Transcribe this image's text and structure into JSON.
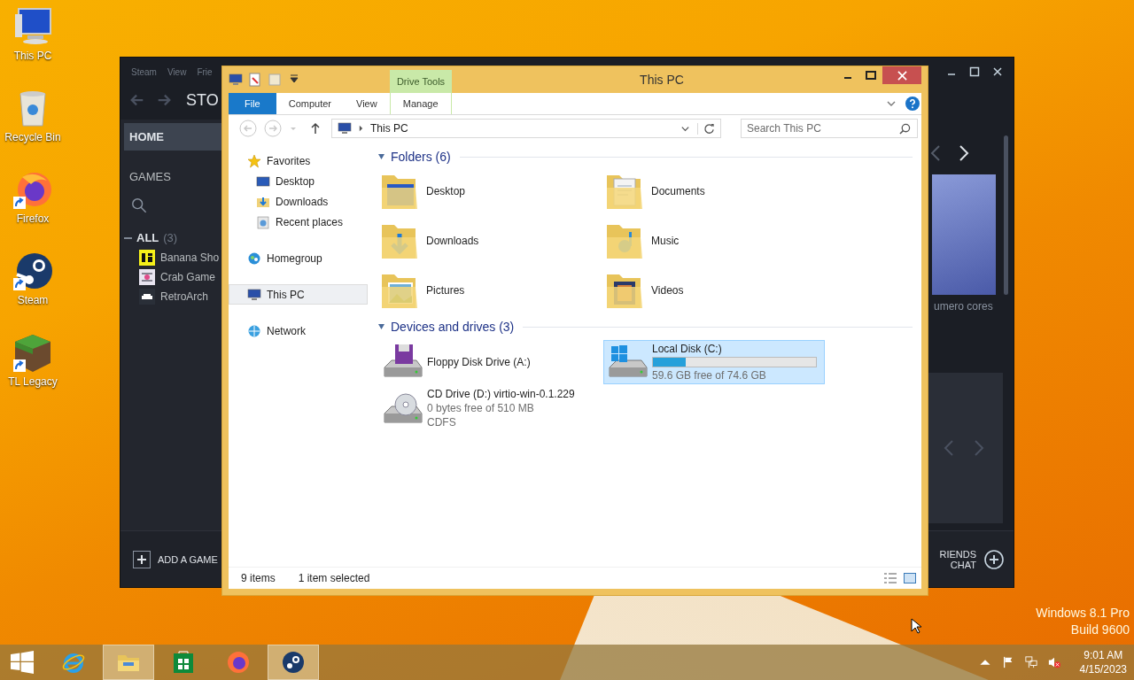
{
  "desktop": {
    "icons": [
      {
        "label": "This PC",
        "kind": "pc",
        "shortcut": false
      },
      {
        "label": "Recycle Bin",
        "kind": "bin",
        "shortcut": false
      },
      {
        "label": "Firefox",
        "kind": "firefox",
        "shortcut": true
      },
      {
        "label": "Steam",
        "kind": "steam",
        "shortcut": true
      },
      {
        "label": "TL Legacy",
        "kind": "grass",
        "shortcut": true
      }
    ],
    "watermark": [
      "Windows 8.1 Pro",
      "Build 9600"
    ]
  },
  "steam_window": {
    "menu": [
      "Steam",
      "View",
      "Frie"
    ],
    "heading": "STO",
    "sidebar": {
      "home": "HOME",
      "games": "GAMES",
      "group_label": "ALL",
      "group_count": "(3)",
      "games_list": [
        {
          "name": "Banana Sho",
          "kind": "banana"
        },
        {
          "name": "Crab Game",
          "kind": "crab"
        },
        {
          "name": "RetroArch",
          "kind": "retro"
        }
      ]
    },
    "card_caption": "umero cores",
    "add_game": "ADD A GAME",
    "friends": [
      "RIENDS",
      "CHAT"
    ]
  },
  "explorer": {
    "title": "This PC",
    "context_group": "Drive Tools",
    "tabs": [
      {
        "label": "File",
        "kind": "file"
      },
      {
        "label": "Computer",
        "kind": "normal"
      },
      {
        "label": "View",
        "kind": "normal"
      },
      {
        "label": "Manage",
        "kind": "contextual"
      }
    ],
    "address": "This PC",
    "search": {
      "placeholder": "Search This PC"
    },
    "nav": [
      {
        "label": "Favorites",
        "kind": "star",
        "selected": false,
        "children": [
          {
            "label": "Desktop",
            "kind": "desktop",
            "selected": false
          },
          {
            "label": "Downloads",
            "kind": "downloads",
            "selected": false
          },
          {
            "label": "Recent places",
            "kind": "recent",
            "selected": false
          }
        ]
      },
      {
        "label": "Homegroup",
        "kind": "homegroup",
        "selected": false
      },
      {
        "label": "This PC",
        "kind": "pc",
        "selected": true
      },
      {
        "label": "Network",
        "kind": "network",
        "selected": false
      }
    ],
    "folders_heading": "Folders (6)",
    "folders": [
      {
        "name": "Desktop",
        "kind": "desktop"
      },
      {
        "name": "Documents",
        "kind": "documents"
      },
      {
        "name": "Downloads",
        "kind": "downloads"
      },
      {
        "name": "Music",
        "kind": "music"
      },
      {
        "name": "Pictures",
        "kind": "pictures"
      },
      {
        "name": "Videos",
        "kind": "videos"
      }
    ],
    "drives_heading": "Devices and drives (3)",
    "drives": [
      {
        "name": "Floppy Disk Drive (A:)",
        "kind": "floppy",
        "selected": false
      },
      {
        "name": "Local Disk (C:)",
        "kind": "system",
        "selected": true,
        "level": 0.2,
        "details": [
          "59.6 GB free of 74.6 GB"
        ]
      },
      {
        "name": "CD Drive (D:) virtio-win-0.1.229",
        "kind": "cd",
        "selected": false,
        "details": [
          "0 bytes free of 510 MB",
          "CDFS"
        ]
      }
    ],
    "status": [
      "9 items",
      "1 item selected"
    ]
  },
  "taskbar": {
    "apps": [
      {
        "kind": "ie",
        "active": false
      },
      {
        "kind": "explorer",
        "active": true
      },
      {
        "kind": "store",
        "active": false
      },
      {
        "kind": "firefox",
        "active": false
      },
      {
        "kind": "steam",
        "active": true
      }
    ],
    "time": "9:01 AM",
    "date": "4/15/2023"
  }
}
